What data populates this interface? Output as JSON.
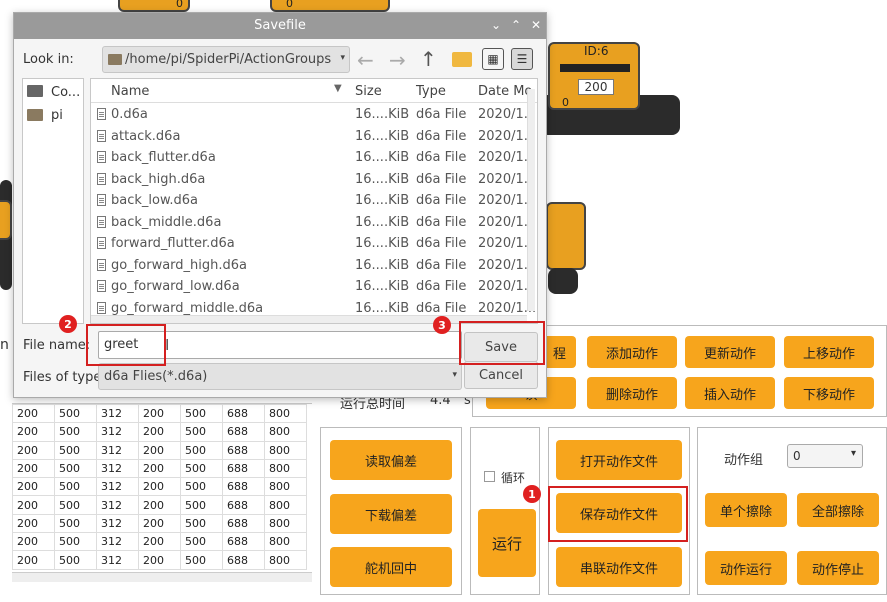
{
  "dialog": {
    "title": "Savefile",
    "look_in_label": "Look in:",
    "look_in_path": "/home/pi/SpiderPi/ActionGroups",
    "sidebar": [
      {
        "label": "Co..."
      },
      {
        "label": "pi"
      }
    ],
    "columns": {
      "name": "Name",
      "size": "Size",
      "type": "Type",
      "date": "Date Mo"
    },
    "files": [
      {
        "name": "0.d6a",
        "size": "16....KiB",
        "type": "d6a File",
        "date": "2020/1..."
      },
      {
        "name": "attack.d6a",
        "size": "16....KiB",
        "type": "d6a File",
        "date": "2020/1..."
      },
      {
        "name": "back_flutter.d6a",
        "size": "16....KiB",
        "type": "d6a File",
        "date": "2020/1..."
      },
      {
        "name": "back_high.d6a",
        "size": "16....KiB",
        "type": "d6a File",
        "date": "2020/1..."
      },
      {
        "name": "back_low.d6a",
        "size": "16....KiB",
        "type": "d6a File",
        "date": "2020/1..."
      },
      {
        "name": "back_middle.d6a",
        "size": "16....KiB",
        "type": "d6a File",
        "date": "2020/1..."
      },
      {
        "name": "forward_flutter.d6a",
        "size": "16....KiB",
        "type": "d6a File",
        "date": "2020/1..."
      },
      {
        "name": "go_forward_high.d6a",
        "size": "16....KiB",
        "type": "d6a File",
        "date": "2020/1..."
      },
      {
        "name": "go_forward_low.d6a",
        "size": "16....KiB",
        "type": "d6a File",
        "date": "2020/1..."
      },
      {
        "name": "go_forward_middle.d6a",
        "size": "16....KiB",
        "type": "d6a File",
        "date": "2020/1..."
      }
    ],
    "file_name_label": "File name:",
    "file_name_value": "greet",
    "files_of_type_label": "Files of type:",
    "files_of_type_value": "d6a Flies(*.d6a)",
    "save_label": "Save",
    "cancel_label": "Cancel"
  },
  "badges": {
    "one": "1",
    "two": "2",
    "three": "3"
  },
  "robot": {
    "servo_id_label": "ID:6",
    "servo_value": "200",
    "zero_a": "0",
    "zero_b": "0",
    "zero_c": "0"
  },
  "run_time": {
    "label": "运行总时间",
    "value": "4.4",
    "unit": "s"
  },
  "left_fragment": "n",
  "action_buttons": {
    "partial_top": "程",
    "partial_bottom": "读",
    "add": "添加动作",
    "update": "更新动作",
    "move_up": "上移动作",
    "delete": "删除动作",
    "insert": "插入动作",
    "move_down": "下移动作"
  },
  "offset_panel": {
    "read_offset": "读取偏差",
    "download_offset": "下载偏差",
    "servo_center": "舵机回中"
  },
  "run_panel": {
    "loop_label": "循环",
    "run": "运行"
  },
  "file_panel": {
    "open": "打开动作文件",
    "save": "保存动作文件",
    "chain": "串联动作文件"
  },
  "group_panel": {
    "label": "动作组",
    "selected": "0",
    "erase_single": "单个擦除",
    "erase_all": "全部擦除",
    "run_action": "动作运行",
    "stop_action": "动作停止"
  },
  "grid_rows": [
    [
      "200",
      "500",
      "312",
      "200",
      "500",
      "688",
      "800"
    ],
    [
      "200",
      "500",
      "312",
      "200",
      "500",
      "688",
      "800"
    ],
    [
      "200",
      "500",
      "312",
      "200",
      "500",
      "688",
      "800"
    ],
    [
      "200",
      "500",
      "312",
      "200",
      "500",
      "688",
      "800"
    ],
    [
      "200",
      "500",
      "312",
      "200",
      "500",
      "688",
      "800"
    ],
    [
      "200",
      "500",
      "312",
      "200",
      "500",
      "688",
      "800"
    ],
    [
      "200",
      "500",
      "312",
      "200",
      "500",
      "688",
      "800"
    ],
    [
      "200",
      "500",
      "312",
      "200",
      "500",
      "688",
      "800"
    ],
    [
      "200",
      "500",
      "312",
      "200",
      "500",
      "688",
      "800"
    ]
  ]
}
